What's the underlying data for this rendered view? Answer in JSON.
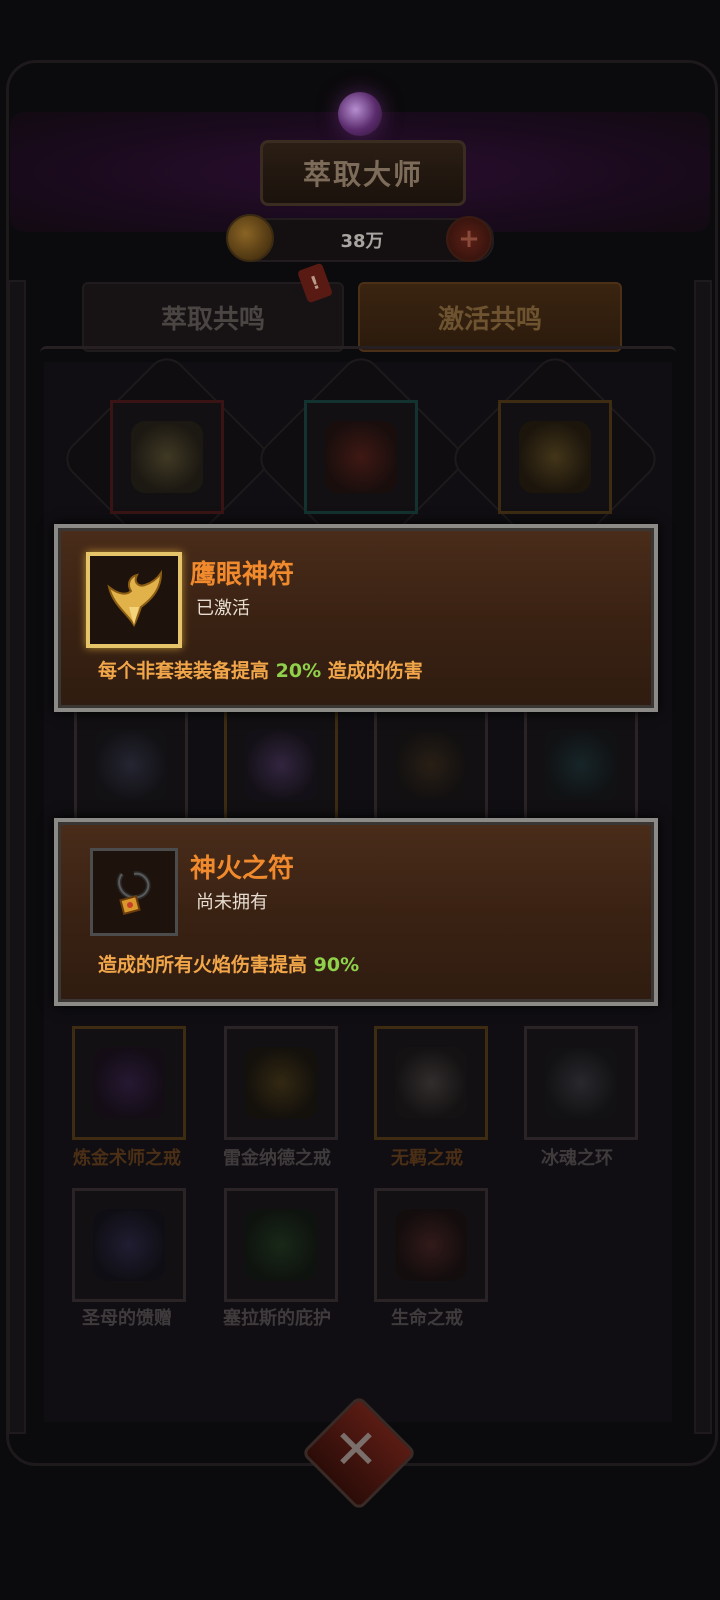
{
  "header": {
    "title": "萃取大师",
    "currency_amount": "38万",
    "plus_symbol": "+",
    "badge_symbol": "!"
  },
  "tabs": {
    "extract_label": "萃取共鸣",
    "activate_label": "激活共鸣"
  },
  "grid": {
    "row3_labels": [
      "炼金术师之戒",
      "雷金纳德之戒",
      "无羁之戒",
      "冰魂之环"
    ],
    "row4_labels": [
      "圣母的馈赠",
      "塞拉斯的庇护",
      "生命之戒"
    ]
  },
  "tooltip1": {
    "name": "鹰眼神符",
    "status": "已激活",
    "desc_prefix": "每个非套装装备提高 ",
    "desc_value": "20%",
    "desc_suffix": " 造成的伤害",
    "icon": "golden-wing-talisman-icon"
  },
  "tooltip2": {
    "name": "神火之符",
    "status": "尚未拥有",
    "desc_prefix": "造成的所有火焰伤害提高 ",
    "desc_value": "90%",
    "icon": "fire-amulet-icon"
  },
  "colors": {
    "tooltip_name": "#f08a2c",
    "tooltip_desc": "#f2a64a",
    "highlight_value": "#8fd14a",
    "gold_frame": "#e6c46a"
  }
}
